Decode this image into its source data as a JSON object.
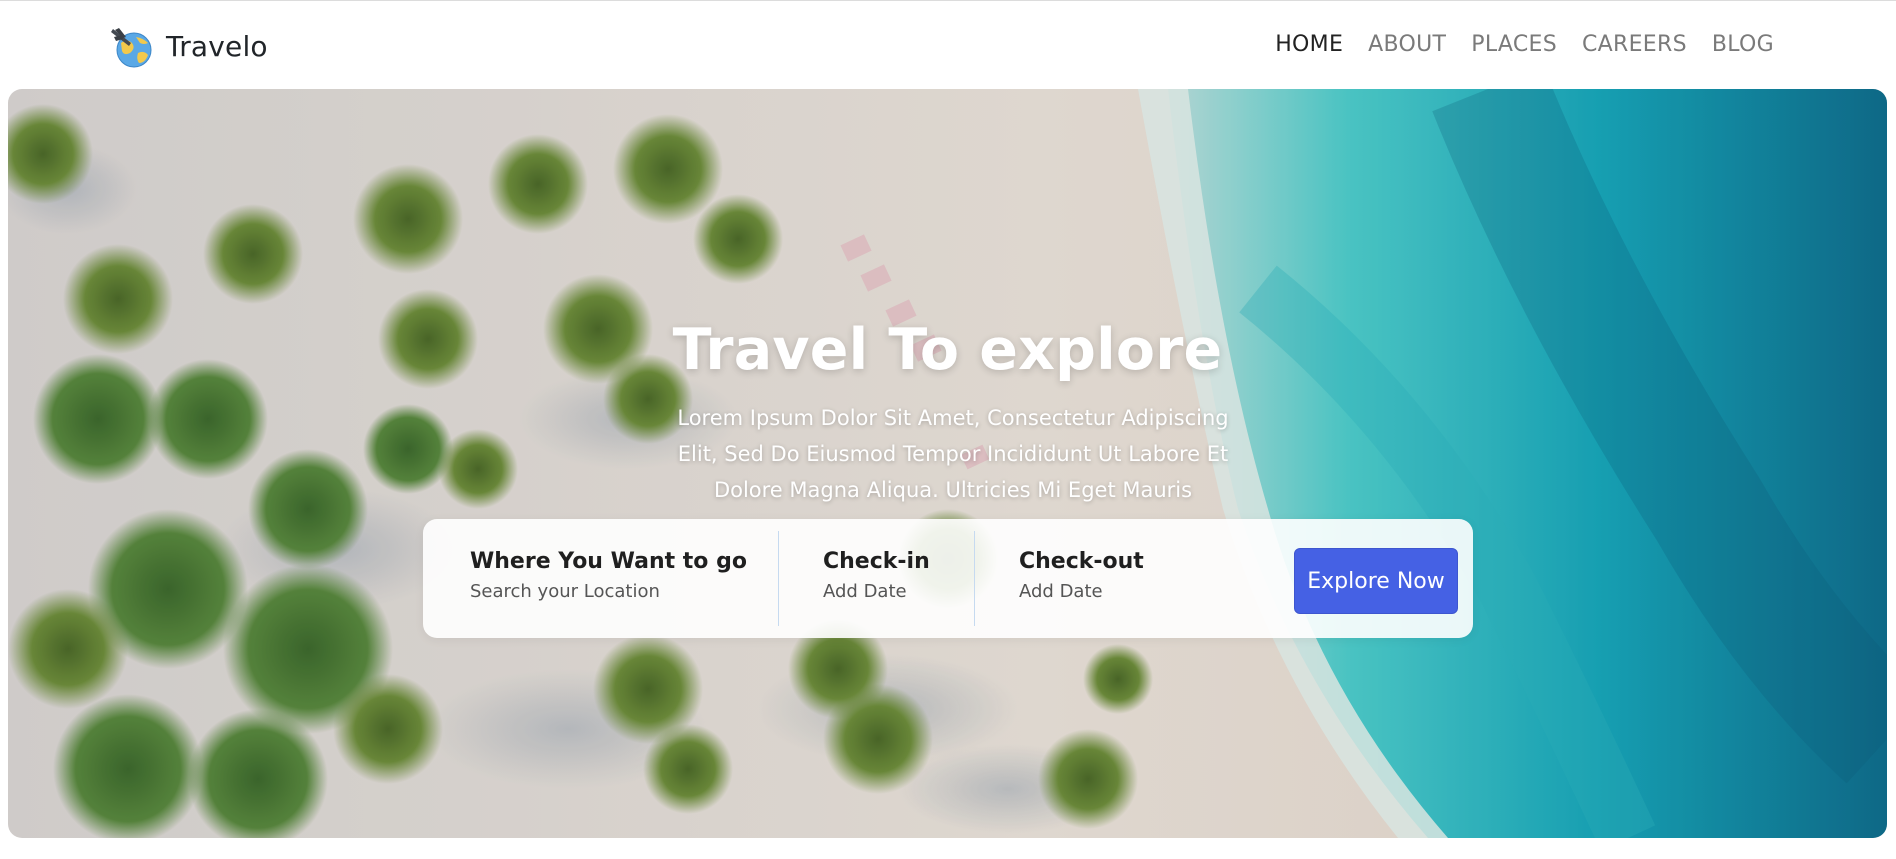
{
  "brand": {
    "name": "Travelo",
    "logo_icon": "globe-airplane-icon"
  },
  "nav": {
    "items": [
      {
        "label": "HOME",
        "active": true
      },
      {
        "label": "ABOUT",
        "active": false
      },
      {
        "label": "PLACES",
        "active": false
      },
      {
        "label": "CAREERS",
        "active": false
      },
      {
        "label": "BLOG",
        "active": false
      }
    ]
  },
  "hero": {
    "title": "Travel To explore",
    "description_lines": [
      "Lorem Ipsum Dolor Sit Amet, Consectetur Adipiscing",
      "Elit, Sed Do Eiusmod Tempor Incididunt Ut Labore Et",
      "Dolore Magna Aliqua. Ultricies Mi Eget Mauris"
    ],
    "background": "aerial-tropical-beach-photo"
  },
  "search": {
    "where": {
      "title": "Where You Want to go",
      "subtitle": "Search your Location"
    },
    "checkin": {
      "title": "Check-in",
      "subtitle": "Add Date"
    },
    "checkout": {
      "title": "Check-out",
      "subtitle": "Add Date"
    },
    "button_label": "Explore Now"
  },
  "colors": {
    "accent": "#4561e4",
    "nav_active": "#222222",
    "nav_inactive": "#7a7a7a",
    "sea": "#1fb8c4",
    "sand": "#e9e2da"
  }
}
